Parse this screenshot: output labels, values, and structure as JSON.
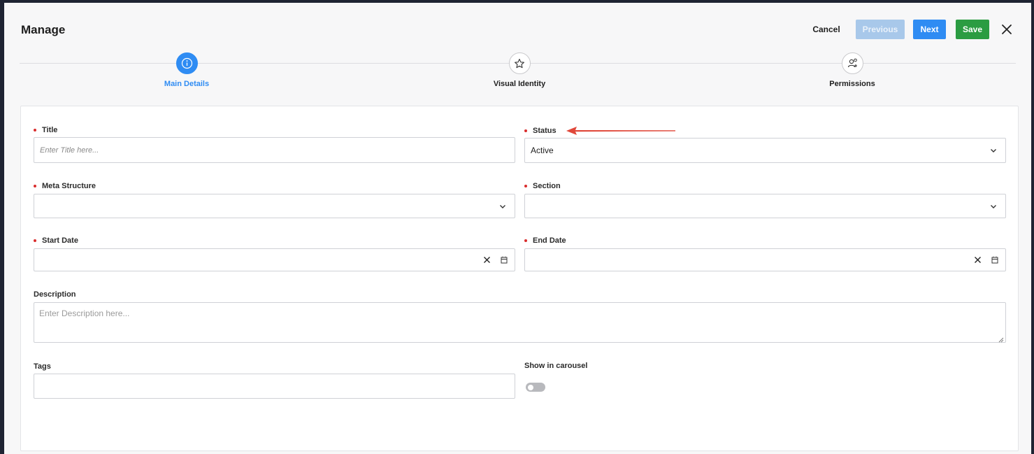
{
  "header": {
    "title": "Manage",
    "cancel_label": "Cancel",
    "previous_label": "Previous",
    "next_label": "Next",
    "save_label": "Save"
  },
  "stepper": {
    "steps": [
      {
        "label": "Main Details",
        "icon": "info-icon",
        "active": true
      },
      {
        "label": "Visual Identity",
        "icon": "star-icon",
        "active": false
      },
      {
        "label": "Permissions",
        "icon": "user-permissions-icon",
        "active": false
      }
    ]
  },
  "form": {
    "title": {
      "label": "Title",
      "placeholder": "Enter Title here...",
      "required": true
    },
    "status": {
      "label": "Status",
      "value": "Active",
      "required": true
    },
    "meta_structure": {
      "label": "Meta Structure",
      "value": "",
      "required": true
    },
    "section": {
      "label": "Section",
      "value": "",
      "required": true
    },
    "start_date": {
      "label": "Start Date",
      "value": "",
      "required": true
    },
    "end_date": {
      "label": "End Date",
      "value": "",
      "required": true
    },
    "description": {
      "label": "Description",
      "placeholder": "Enter Description here..."
    },
    "tags": {
      "label": "Tags",
      "value": ""
    },
    "show_in_carousel": {
      "label": "Show in carousel",
      "enabled": false
    }
  },
  "colors": {
    "accent": "#2f8cf3",
    "save": "#2b9c42",
    "previous_disabled": "#a8c8ea",
    "required_dot": "#d92d2d",
    "annotation_arrow": "#e0483a"
  }
}
